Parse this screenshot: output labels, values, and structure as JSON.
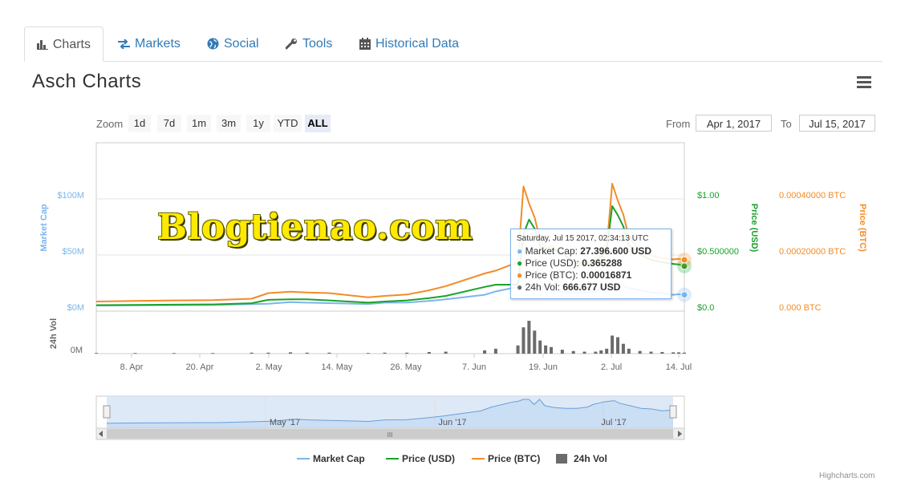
{
  "tabs": [
    {
      "label": "Charts",
      "icon": "bar-chart-icon"
    },
    {
      "label": "Markets",
      "icon": "exchange-arrows-icon"
    },
    {
      "label": "Social",
      "icon": "globe-icon"
    },
    {
      "label": "Tools",
      "icon": "wrench-icon"
    },
    {
      "label": "Historical Data",
      "icon": "calendar-icon"
    }
  ],
  "page_title": "Asch Charts",
  "range_selector": {
    "zoom_label": "Zoom",
    "buttons": [
      "1d",
      "7d",
      "1m",
      "3m",
      "1y",
      "YTD",
      "ALL"
    ],
    "selected": "ALL",
    "from_label": "From",
    "from_value": "Apr 1, 2017",
    "to_label": "To",
    "to_value": "Jul 15, 2017"
  },
  "watermark": "Blogtienao.com",
  "credit": "Highcharts.com",
  "colors": {
    "market_cap": "#7cb5ec",
    "price_usd": "#1aa22b",
    "price_btc": "#f28c28",
    "volume": "#6b6b6b",
    "tab_link": "#337ab7"
  },
  "tooltip": {
    "header": "Saturday, Jul 15 2017, 02:34:13 UTC",
    "rows": [
      {
        "label": "Market Cap:",
        "value": "27.396.600 USD"
      },
      {
        "label": "Price (USD):",
        "value": "0.365288"
      },
      {
        "label": "Price (BTC):",
        "value": "0.00016871"
      },
      {
        "label": "24h Vol:",
        "value": "666.677 USD"
      }
    ]
  },
  "chart_data": {
    "type": "line",
    "x_tick_labels": [
      "8. Apr",
      "20. Apr",
      "2. May",
      "14. May",
      "26. May",
      "7. Jun",
      "19. Jun",
      "2. Jul",
      "14. Jul"
    ],
    "navigator_labels": [
      "May '17",
      "Jun '17",
      "Jul '17"
    ],
    "axes": {
      "market_cap": {
        "label": "Market Cap",
        "ticks": [
          "$0M",
          "$50M",
          "$100M"
        ],
        "range": [
          0,
          100
        ]
      },
      "price_usd": {
        "label": "Price (USD)",
        "ticks": [
          "$0.0",
          "$0.500000",
          "$1.00"
        ],
        "range": [
          0,
          1
        ]
      },
      "price_btc": {
        "label": "Price (BTC)",
        "ticks": [
          "0.000 BTC",
          "0.00020000 BTC",
          "0.00040000 BTC"
        ],
        "range": [
          0,
          0.0004
        ]
      },
      "volume": {
        "label": "24h Vol",
        "ticks": [
          "0M"
        ]
      }
    },
    "x": [
      0,
      7,
      14,
      21,
      28,
      31,
      35,
      38,
      42,
      49,
      52,
      56,
      60,
      63,
      70,
      72,
      76,
      77,
      78,
      79,
      80,
      81,
      82,
      84,
      86,
      88,
      90,
      91,
      92,
      93,
      94,
      95,
      96,
      98,
      100,
      102,
      104,
      105,
      106
    ],
    "series": [
      {
        "name": "Market Cap",
        "values": [
          1.4,
          1.6,
          1.8,
          1.9,
          2.7,
          3.0,
          4.5,
          4.0,
          3.6,
          2.8,
          4.0,
          4.1,
          5.6,
          7.0,
          11.0,
          14.0,
          18.0,
          18.5,
          20.0,
          20.0,
          16.0,
          20.0,
          15.0,
          13.5,
          13.0,
          13.0,
          14.0,
          16.0,
          17.0,
          18.0,
          18.5,
          19.0,
          17.0,
          15.0,
          13.0,
          12.5,
          11.0,
          11.5,
          11.0
        ]
      },
      {
        "name": "Price (USD)",
        "values": [
          0.018,
          0.02,
          0.022,
          0.024,
          0.035,
          0.065,
          0.07,
          0.07,
          0.06,
          0.04,
          0.05,
          0.06,
          0.08,
          0.1,
          0.18,
          0.2,
          0.2,
          0.65,
          0.78,
          0.7,
          0.55,
          0.47,
          0.52,
          0.48,
          0.4,
          0.38,
          0.4,
          0.45,
          0.5,
          0.9,
          0.82,
          0.72,
          0.55,
          0.47,
          0.42,
          0.4,
          0.385,
          0.38,
          0.365288
        ]
      },
      {
        "name": "Price (BTC)",
        "values": [
          2e-05,
          2.2e-05,
          2.4e-05,
          2.5e-05,
          3e-05,
          5e-05,
          5.5e-05,
          5.2e-05,
          5e-05,
          3.5e-05,
          4e-05,
          4.5e-05,
          6e-05,
          7.5e-05,
          0.00012,
          0.00013,
          0.00016,
          0.00043,
          0.00037,
          0.00032,
          0.00024,
          0.00021,
          0.00022,
          0.00019,
          0.000165,
          0.00016,
          0.000165,
          0.00019,
          0.00021,
          0.00044,
          0.00038,
          0.00033,
          0.00025,
          0.0002,
          0.000185,
          0.000175,
          0.00017,
          0.000172,
          0.00016871
        ]
      },
      {
        "name": "24h Vol",
        "values": [
          0.02,
          0.02,
          0.02,
          0.02,
          0.03,
          0.03,
          0.04,
          0.03,
          0.03,
          0.02,
          0.03,
          0.03,
          0.05,
          0.06,
          0.1,
          0.15,
          0.25,
          0.8,
          1.0,
          0.7,
          0.4,
          0.25,
          0.2,
          0.12,
          0.08,
          0.06,
          0.06,
          0.1,
          0.15,
          0.55,
          0.5,
          0.3,
          0.15,
          0.08,
          0.06,
          0.05,
          0.04,
          0.04,
          0.03
        ]
      }
    ],
    "legend": [
      "Market Cap",
      "Price (USD)",
      "Price (BTC)",
      "24h Vol"
    ],
    "legend_position": "bottom",
    "grid": true
  }
}
